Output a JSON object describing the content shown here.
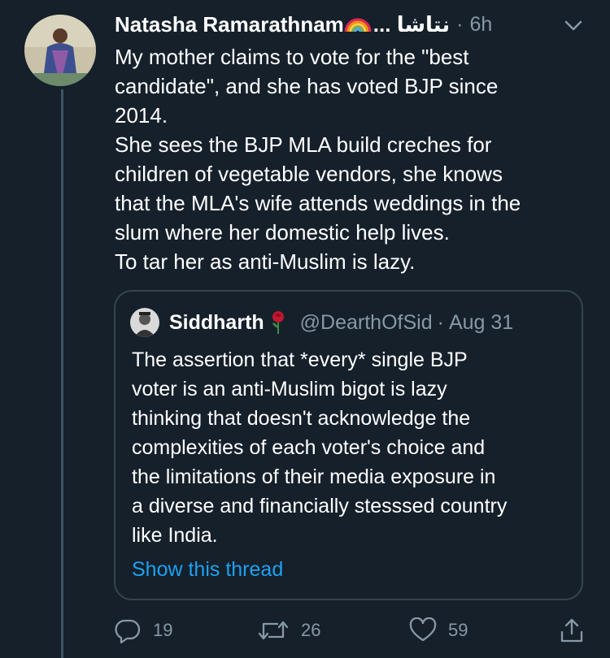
{
  "tweet": {
    "author_name": "Natasha Ramarathnam",
    "author_name_rtl": "... نتاشا",
    "separator": "·",
    "timestamp": "6h",
    "text_lines": [
      "My mother claims to vote for the \"best",
      "candidate\", and she has voted BJP since",
      "2014.",
      "She sees the BJP MLA build creches for",
      "children of vegetable vendors, she knows",
      "that the MLA's wife attends weddings in the",
      "slum where her domestic help lives.",
      "To tar her as anti-Muslim is lazy."
    ]
  },
  "quoted_tweet": {
    "author_name": "Siddharth",
    "handle": "@DearthOfSid",
    "separator": "·",
    "date": "Aug 31",
    "text_lines": [
      "The assertion that *every* single BJP",
      "voter is an anti-Muslim bigot is lazy",
      "thinking that doesn't acknowledge the",
      "complexities of each voter's choice and",
      "the limitations of their media exposure in",
      "a diverse and financially stesssed country",
      "like India."
    ],
    "show_thread_label": "Show this thread"
  },
  "actions": {
    "reply_count": "19",
    "retweet_count": "26",
    "like_count": "59"
  },
  "icons": {
    "author_emoji": "rainbow-icon",
    "quote_author_emoji": "rose-icon",
    "menu": "chevron-down-icon",
    "reply": "reply-icon",
    "retweet": "retweet-icon",
    "like": "heart-icon",
    "share": "share-icon"
  },
  "colors": {
    "background": "#15202b",
    "text_primary": "#ffffff",
    "text_secondary": "#8899a6",
    "link": "#1da1f2",
    "border": "#38444d"
  }
}
